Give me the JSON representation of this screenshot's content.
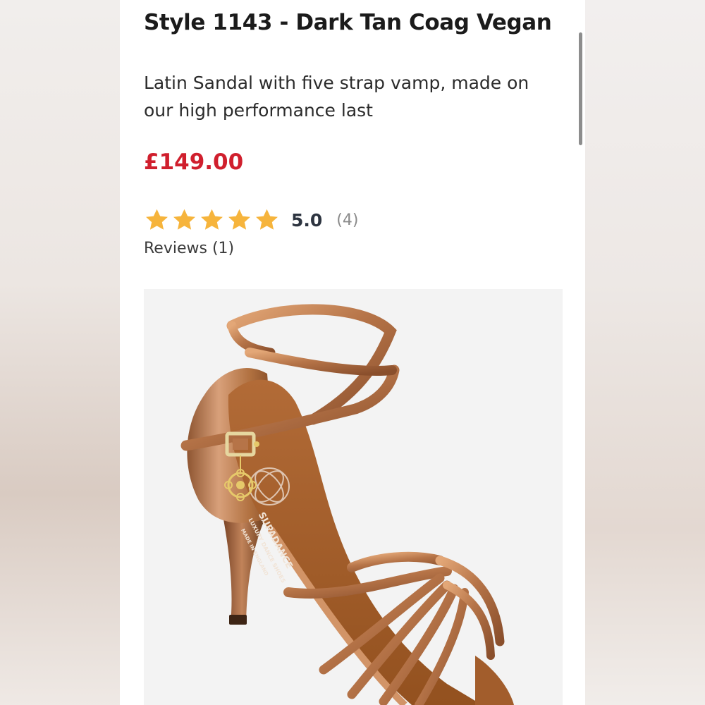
{
  "product": {
    "title": "Style 1143 - Dark Tan Coag Vegan",
    "description": "Latin Sandal with five strap vamp, made on our high performance last",
    "price": "£149.00",
    "rating": {
      "value": "5.0",
      "count": "(4)",
      "stars": 5,
      "star_color": "#f6b43c"
    },
    "reviews_link": "Reviews (1)",
    "image": {
      "subject": "dark tan latin dance sandal",
      "insole_print": [
        "SUPADANCE",
        "LUXURY DANCE SHOES",
        "MADE IN ENGLAND"
      ]
    }
  },
  "colors": {
    "price": "#d01f2d",
    "title": "#1b1b1b",
    "star": "#f6b43c"
  }
}
